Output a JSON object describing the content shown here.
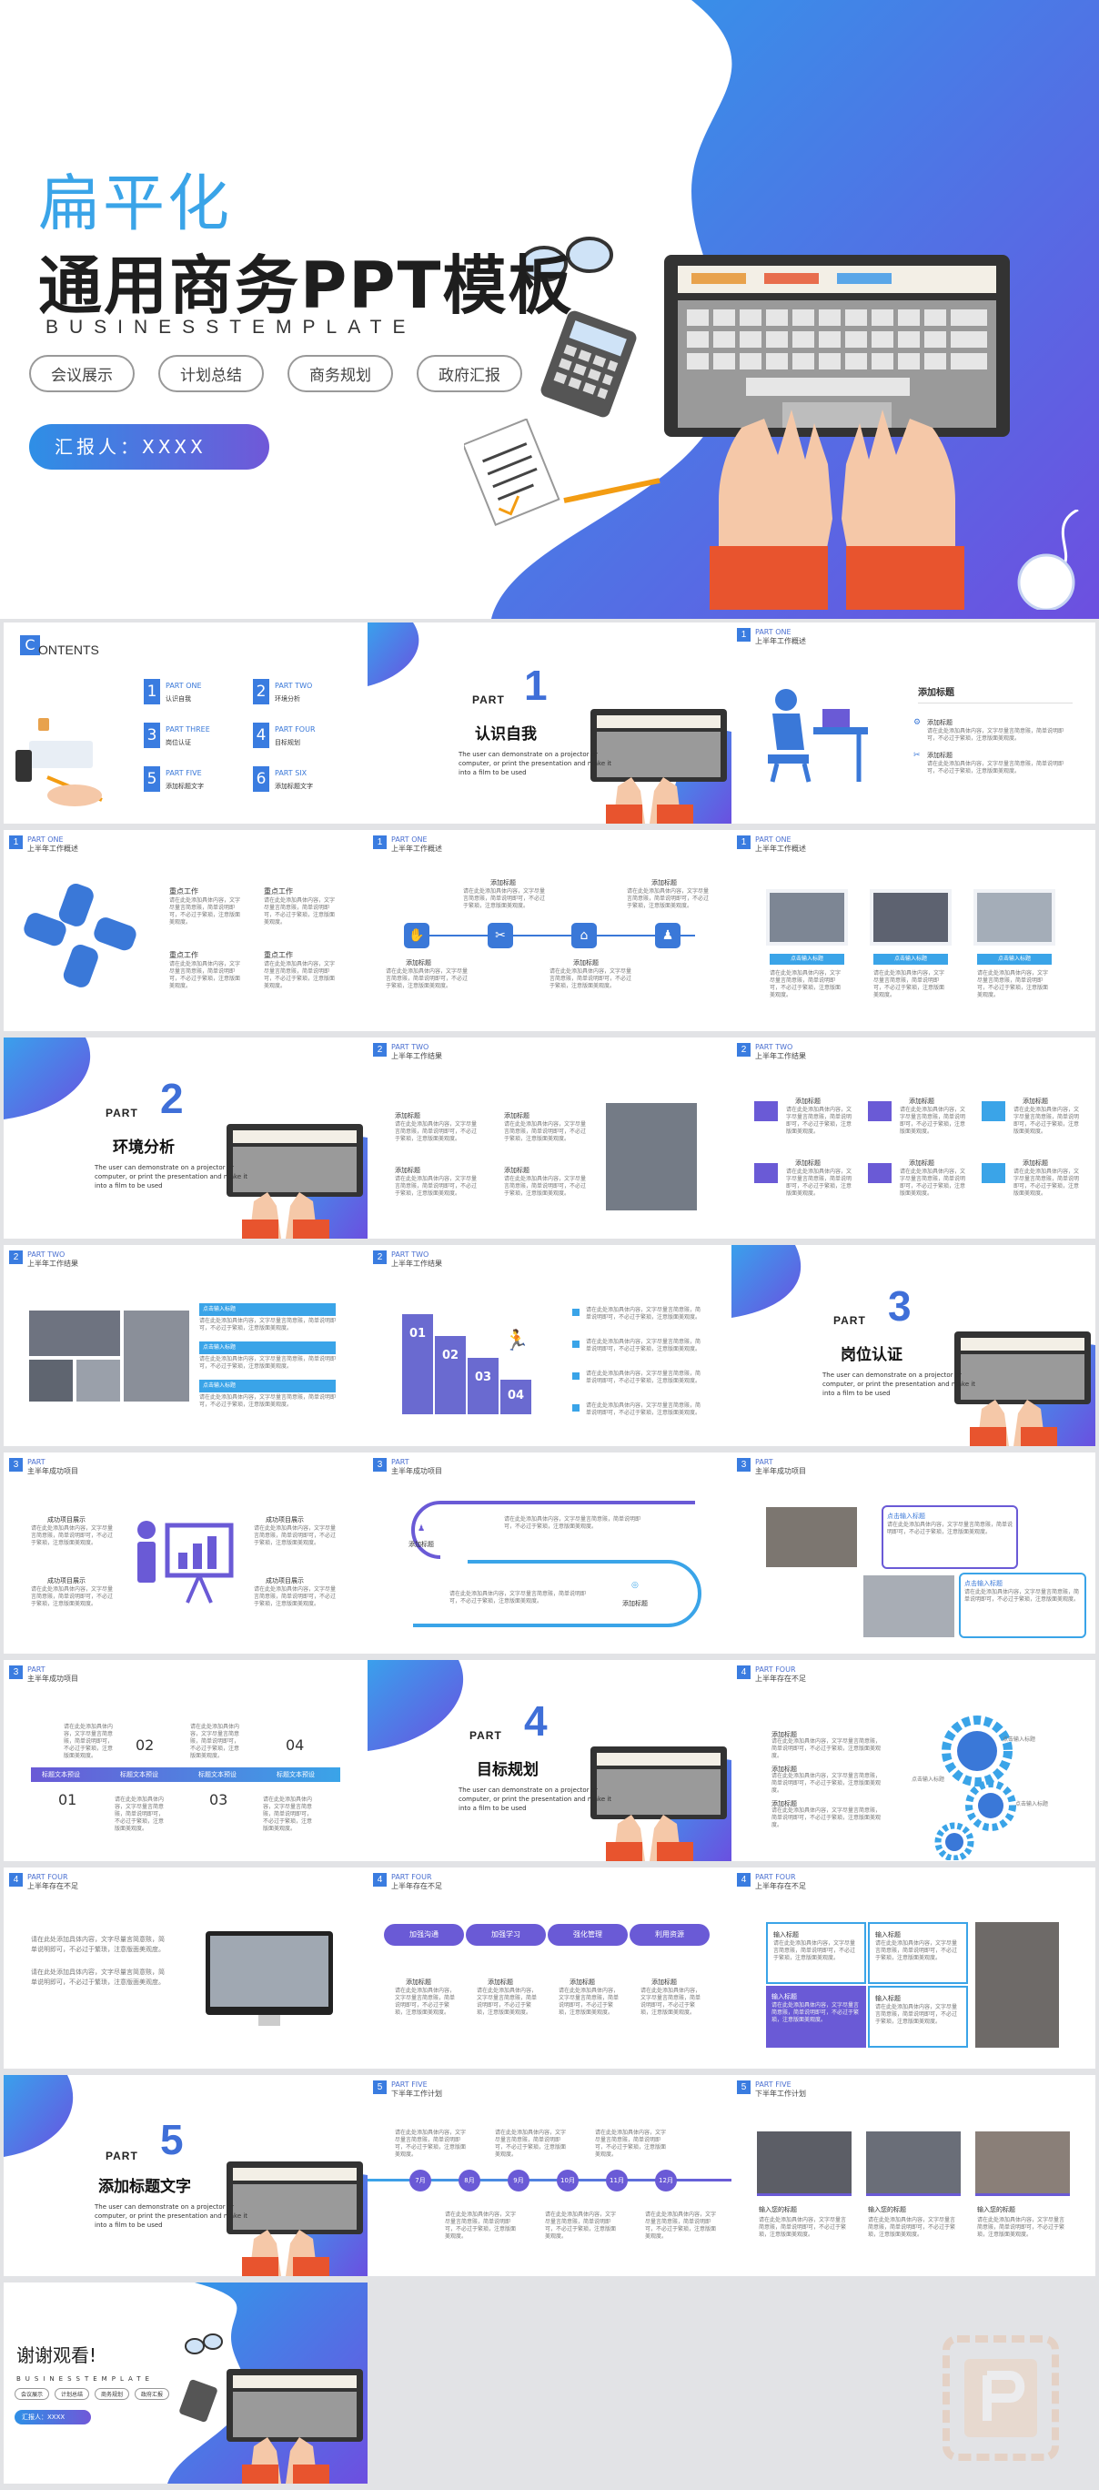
{
  "hero": {
    "title_line1": "扁平化",
    "title_line2": "通用商务PPT模板",
    "subtitle": "BUSINESSTEMPLATE",
    "tags": [
      "会议展示",
      "计划总结",
      "商务规划",
      "政府汇报"
    ],
    "reporter": "汇报人：XXXX"
  },
  "contents": {
    "title": "ONTENTS",
    "title_initial": "C",
    "items": [
      {
        "num": "1",
        "label": "PART ONE",
        "sub": "认识自我"
      },
      {
        "num": "2",
        "label": "PART TWO",
        "sub": "环境分析"
      },
      {
        "num": "3",
        "label": "PART THREE",
        "sub": "岗位认证"
      },
      {
        "num": "4",
        "label": "PART FOUR",
        "sub": "目标规划"
      },
      {
        "num": "5",
        "label": "PART FIVE",
        "sub": "添加标题文字"
      },
      {
        "num": "6",
        "label": "PART SIX",
        "sub": "添加标题文字"
      }
    ]
  },
  "part_word": "PART",
  "part_desc": "The user can demonstrate on a projector or computer, or print the presentation and make it into a film to be used",
  "parts": [
    {
      "num": "1",
      "title": "认识自我"
    },
    {
      "num": "2",
      "title": "环境分析"
    },
    {
      "num": "3",
      "title": "岗位认证"
    },
    {
      "num": "4",
      "title": "目标规划"
    },
    {
      "num": "5",
      "title": "添加标题文字"
    }
  ],
  "headers": {
    "p1": {
      "num": "1",
      "part": "PART ONE",
      "sub": "上半年工作概述"
    },
    "p2": {
      "num": "2",
      "part": "PART TWO",
      "sub": "上半年工作结果"
    },
    "p3": {
      "num": "3",
      "part": "PART",
      "sub": "主半年成功项目"
    },
    "p4": {
      "num": "4",
      "part": "PART FOUR",
      "sub": "上半年存在不足"
    },
    "p5": {
      "num": "5",
      "part": "PART FIVE",
      "sub": "下半年工作计划"
    }
  },
  "labels": {
    "add_title": "添加标题",
    "focus_work": "重点工作",
    "input_title": "输入标题",
    "input_your_title": "输入您的标题",
    "success_show": "成功项目展示",
    "click_input": "点击输入标题",
    "long_text": "请在此处添加具体内容，文字尽量言简意赅，简单说明即可，不必过于繁琐，注意版面美观度。"
  },
  "steps": [
    "01",
    "02",
    "03",
    "04"
  ],
  "tabs": [
    "加强沟通",
    "加强学习",
    "强化管理",
    "利用资源"
  ],
  "months": [
    "7月",
    "8月",
    "9月",
    "10月",
    "11月",
    "12月"
  ],
  "timeline_input": "标题文本预设",
  "thanks": {
    "title": "谢谢观看!",
    "subtitle": "BUSINESSTEMPLATE",
    "tags": [
      "会议展示",
      "计划总结",
      "商务规划",
      "政府汇报"
    ],
    "reporter": "汇报人：XXXX"
  },
  "colors": {
    "primary": "#3a78d8",
    "purple": "#6a5ad6",
    "accent": "#3aa4e8"
  }
}
